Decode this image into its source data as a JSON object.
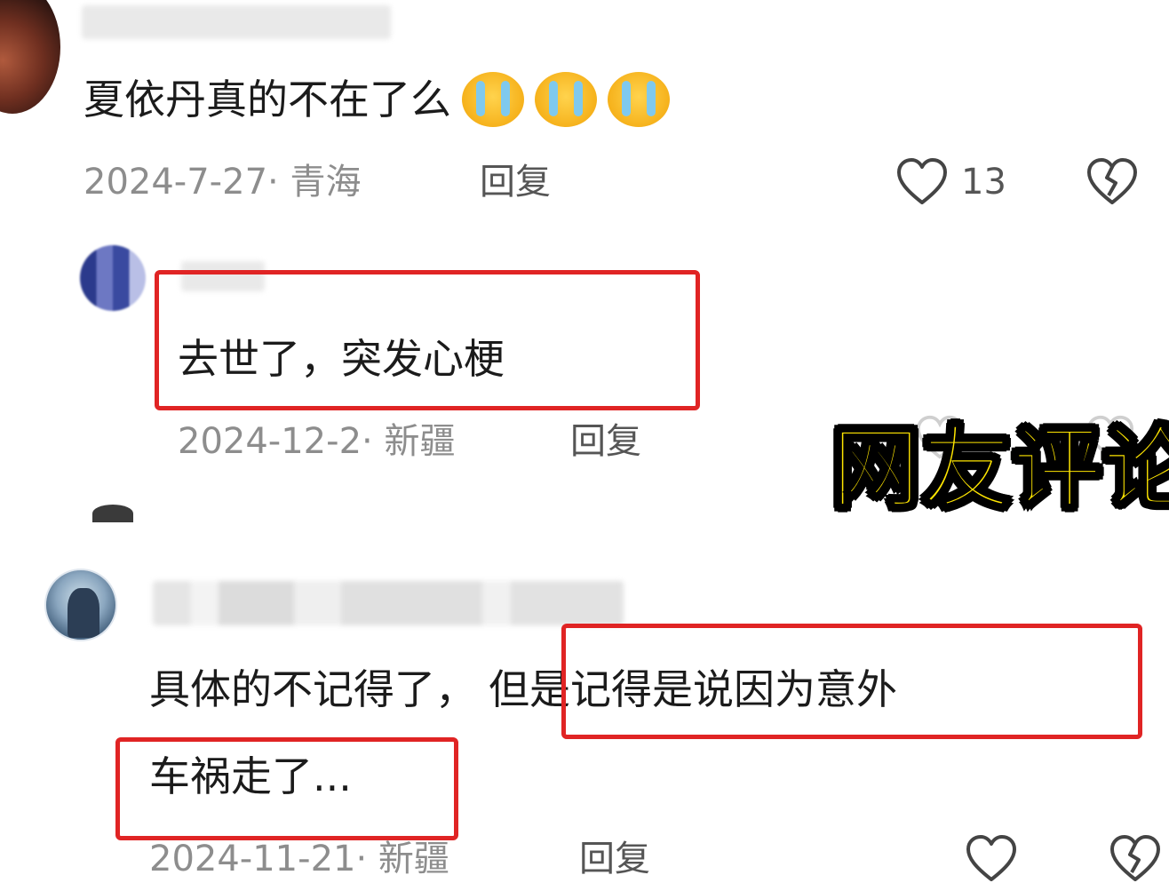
{
  "comments": [
    {
      "text": "夏依丹真的不在了么",
      "emojis": [
        "crying-face",
        "crying-face",
        "crying-face"
      ],
      "meta": "2024-7-27· 青海",
      "reply_label": "回复",
      "likes": "13"
    },
    {
      "text": "去世了，突发心梗",
      "meta": "2024-12-2· 新疆",
      "reply_label": "回复"
    },
    {
      "text_line1_plain": "具体的不记得了，",
      "text_line1_highlight": "但是记得是说因为意外",
      "text_line2": "车祸走了...",
      "meta": "2024-11-21· 新疆",
      "reply_label": "回复"
    }
  ],
  "overlay": {
    "title": "网友评论"
  },
  "colors": {
    "highlight_box": "#e02424",
    "overlay_text": "#ffe600",
    "meta_text": "#8d8d8d"
  }
}
